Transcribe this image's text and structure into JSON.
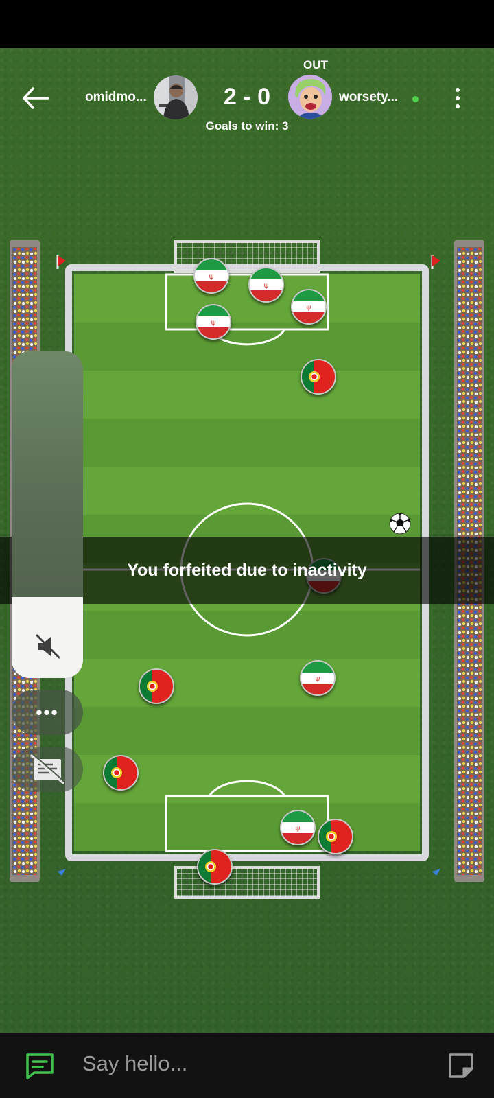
{
  "header": {
    "player_left": "omidmo...",
    "player_right": "worsety...",
    "score": "2 - 0",
    "goals_to_win": "Goals to win: 3",
    "right_status": "OUT",
    "online_color": "#4ed04e"
  },
  "icons": {
    "back": "arrow-left-icon",
    "menu": "kebab-menu-icon",
    "sound": "speaker-muted-icon",
    "more": "more-dots-icon",
    "chat_off": "chat-disabled-icon",
    "chat": "chat-icon",
    "sticker": "sticker-icon"
  },
  "game": {
    "message": "You forfeited due to inactivity",
    "teams": {
      "top": "Iran",
      "bottom": "Portugal"
    },
    "colors": {
      "grass_light": "#6aa83a",
      "grass_dark": "#4f8c2c",
      "line": "#ffffff",
      "portugal_red": "#e0231f",
      "portugal_green": "#0c7b34",
      "iran_green": "#1f9a44",
      "iran_red": "#d42a2a"
    }
  },
  "side_menu": {
    "more_label": "•••"
  },
  "chat_bar": {
    "placeholder": "Say hello..."
  }
}
